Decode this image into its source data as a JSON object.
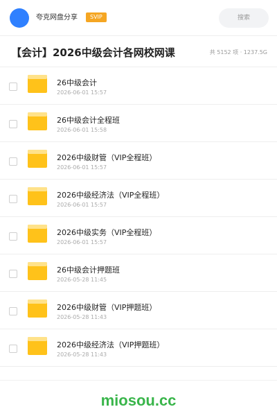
{
  "header": {
    "brand": "夸克网盘分享",
    "badge": "SVIP",
    "search_label": "搜索"
  },
  "folder": {
    "title": "【会计】2026中级会计各网校网课",
    "summary": "共 5152 项 · 1237.5G"
  },
  "items": [
    {
      "name": "26中级会计",
      "date": "2026-06-01 15:57",
      "icon": "folder-icon"
    },
    {
      "name": "26中级会计全程班",
      "date": "2026-06-01 15:58",
      "icon": "folder-icon"
    },
    {
      "name": "2026中级财管（VIP全程班）",
      "date": "2026-06-01 15:57",
      "icon": "folder-icon"
    },
    {
      "name": "2026中级经济法（VIP全程班）",
      "date": "2026-06-01 15:57",
      "icon": "folder-icon"
    },
    {
      "name": "2026中级实务（VIP全程班）",
      "date": "2026-06-01 15:57",
      "icon": "folder-icon"
    },
    {
      "name": "26中级会计押题班",
      "date": "2026-05-28 11:45",
      "icon": "folder-icon"
    },
    {
      "name": "2026中级财管（VIP押题班）",
      "date": "2026-05-28 11:43",
      "icon": "folder-icon"
    },
    {
      "name": "2026中级经济法（VIP押题班）",
      "date": "2026-05-28 11:43",
      "icon": "folder-icon"
    }
  ],
  "footer": {
    "brand": "miosou.cc"
  },
  "colors": {
    "avatar": "#2f80ff",
    "badge": "#f5a623",
    "folder": "#ffc21a",
    "footer_brand": "#39b54a"
  }
}
